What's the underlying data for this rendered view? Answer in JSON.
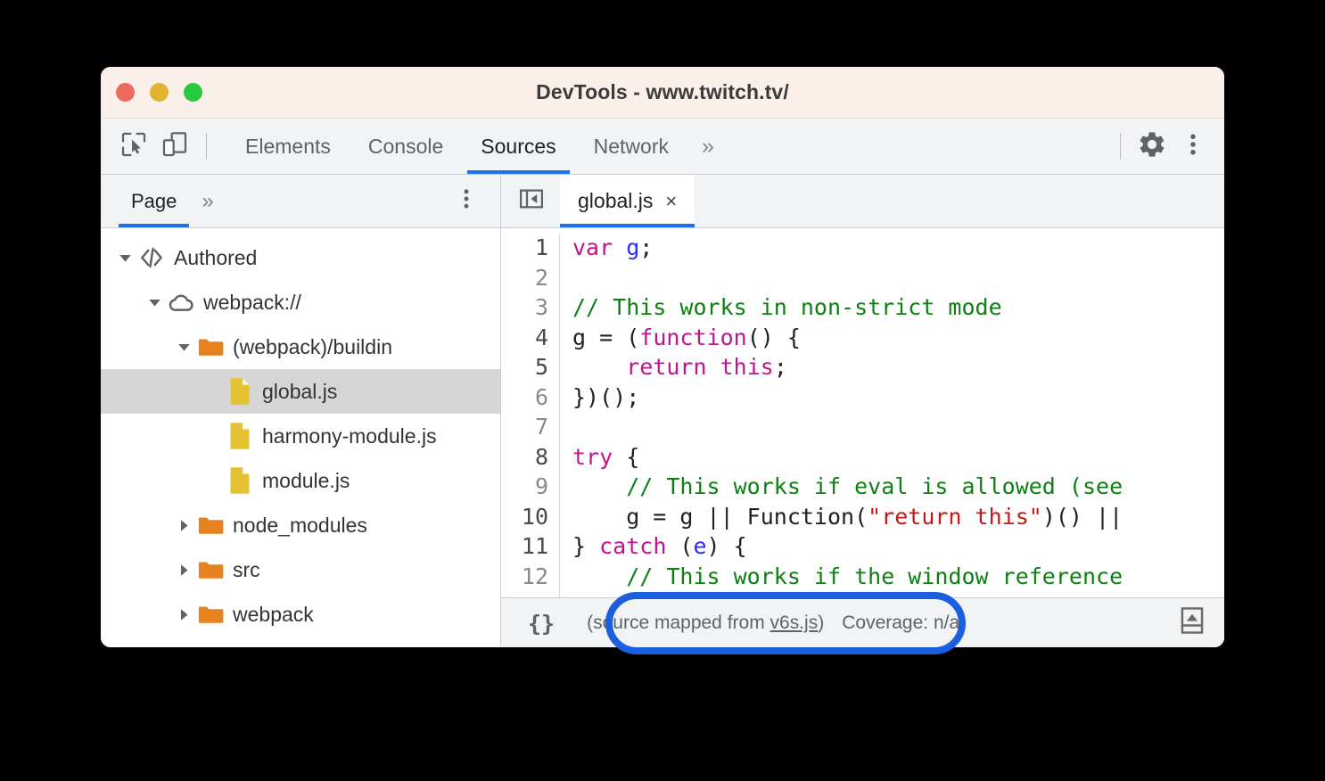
{
  "window": {
    "title": "DevTools - www.twitch.tv/",
    "traffic_lights": [
      "close",
      "minimize",
      "maximize"
    ],
    "colors": {
      "titlebar_bg": "#fbf0e9",
      "toolbar_bg": "#f1f3f4",
      "accent": "#1a73e8",
      "annotation_ring": "#1a5fe0",
      "folder": "#e8821e",
      "file": "#e4c234",
      "selection": "#d6d6d6"
    }
  },
  "toolbar": {
    "inspect_icon": "inspect-element-icon",
    "device_icon": "device-toolbar-icon",
    "tabs": [
      {
        "label": "Elements",
        "active": false
      },
      {
        "label": "Console",
        "active": false
      },
      {
        "label": "Sources",
        "active": true
      },
      {
        "label": "Network",
        "active": false
      }
    ],
    "more_tabs_label": "»",
    "settings_icon": "gear-icon",
    "menu_icon": "kebab-menu-icon"
  },
  "navigator": {
    "tabs": [
      {
        "label": "Page",
        "active": true
      }
    ],
    "more_label": "»",
    "menu_icon": "kebab-menu-icon",
    "tree": [
      {
        "label": "Authored",
        "icon": "code-brackets-icon",
        "indent": 0,
        "twisty": "expanded",
        "selected": false
      },
      {
        "label": "webpack://",
        "icon": "cloud-icon",
        "indent": 1,
        "twisty": "expanded",
        "selected": false
      },
      {
        "label": "(webpack)/buildin",
        "icon": "folder-icon",
        "indent": 2,
        "twisty": "expanded",
        "selected": false
      },
      {
        "label": "global.js",
        "icon": "js-file-icon",
        "indent": 3,
        "twisty": "none",
        "selected": true
      },
      {
        "label": "harmony-module.js",
        "icon": "js-file-icon",
        "indent": 3,
        "twisty": "none",
        "selected": false
      },
      {
        "label": "module.js",
        "icon": "js-file-icon",
        "indent": 3,
        "twisty": "none",
        "selected": false
      },
      {
        "label": "node_modules",
        "icon": "folder-icon",
        "indent": 2,
        "twisty": "collapsed",
        "selected": false
      },
      {
        "label": "src",
        "icon": "folder-icon",
        "indent": 2,
        "twisty": "collapsed",
        "selected": false
      },
      {
        "label": "webpack",
        "icon": "folder-icon",
        "indent": 2,
        "twisty": "collapsed",
        "selected": false
      }
    ]
  },
  "editor": {
    "sidebar_toggle_icon": "collapse-sidebar-icon",
    "tabs": [
      {
        "label": "global.js",
        "active": true,
        "close_label": "×"
      }
    ],
    "gutter": [
      {
        "number": "1",
        "executable": true
      },
      {
        "number": "2",
        "executable": false
      },
      {
        "number": "3",
        "executable": false
      },
      {
        "number": "4",
        "executable": true
      },
      {
        "number": "5",
        "executable": true
      },
      {
        "number": "6",
        "executable": false
      },
      {
        "number": "7",
        "executable": false
      },
      {
        "number": "8",
        "executable": true
      },
      {
        "number": "9",
        "executable": false
      },
      {
        "number": "10",
        "executable": true
      },
      {
        "number": "11",
        "executable": true
      },
      {
        "number": "12",
        "executable": false
      }
    ],
    "code_lines": [
      [
        {
          "t": "var",
          "c": "k"
        },
        {
          "t": " ",
          "c": "p"
        },
        {
          "t": "g",
          "c": "v"
        },
        {
          "t": ";",
          "c": "p"
        }
      ],
      [],
      [
        {
          "t": "// This works in non-strict mode",
          "c": "c"
        }
      ],
      [
        {
          "t": "g = (",
          "c": "p"
        },
        {
          "t": "function",
          "c": "k"
        },
        {
          "t": "() {",
          "c": "p"
        }
      ],
      [
        {
          "t": "    ",
          "c": "p"
        },
        {
          "t": "return",
          "c": "k"
        },
        {
          "t": " ",
          "c": "p"
        },
        {
          "t": "this",
          "c": "k"
        },
        {
          "t": ";",
          "c": "p"
        }
      ],
      [
        {
          "t": "})();",
          "c": "p"
        }
      ],
      [],
      [
        {
          "t": "try",
          "c": "k"
        },
        {
          "t": " {",
          "c": "p"
        }
      ],
      [
        {
          "t": "    ",
          "c": "p"
        },
        {
          "t": "// This works if eval is allowed (see",
          "c": "c"
        }
      ],
      [
        {
          "t": "    g = g || Function(",
          "c": "p"
        },
        {
          "t": "\"return this\"",
          "c": "s"
        },
        {
          "t": ")() ||",
          "c": "p"
        }
      ],
      [
        {
          "t": "} ",
          "c": "p"
        },
        {
          "t": "catch",
          "c": "k"
        },
        {
          "t": " (",
          "c": "p"
        },
        {
          "t": "e",
          "c": "v"
        },
        {
          "t": ") {",
          "c": "p"
        }
      ],
      [
        {
          "t": "    ",
          "c": "p"
        },
        {
          "t": "// This works if the window reference",
          "c": "c"
        }
      ]
    ]
  },
  "status_bar": {
    "format_label": "{}",
    "sourcemap_prefix": "(source mapped from ",
    "sourcemap_link": "v6s.js",
    "sourcemap_suffix": ")",
    "coverage_label": "Coverage: n/a",
    "popout_icon": "show-drawer-icon"
  }
}
